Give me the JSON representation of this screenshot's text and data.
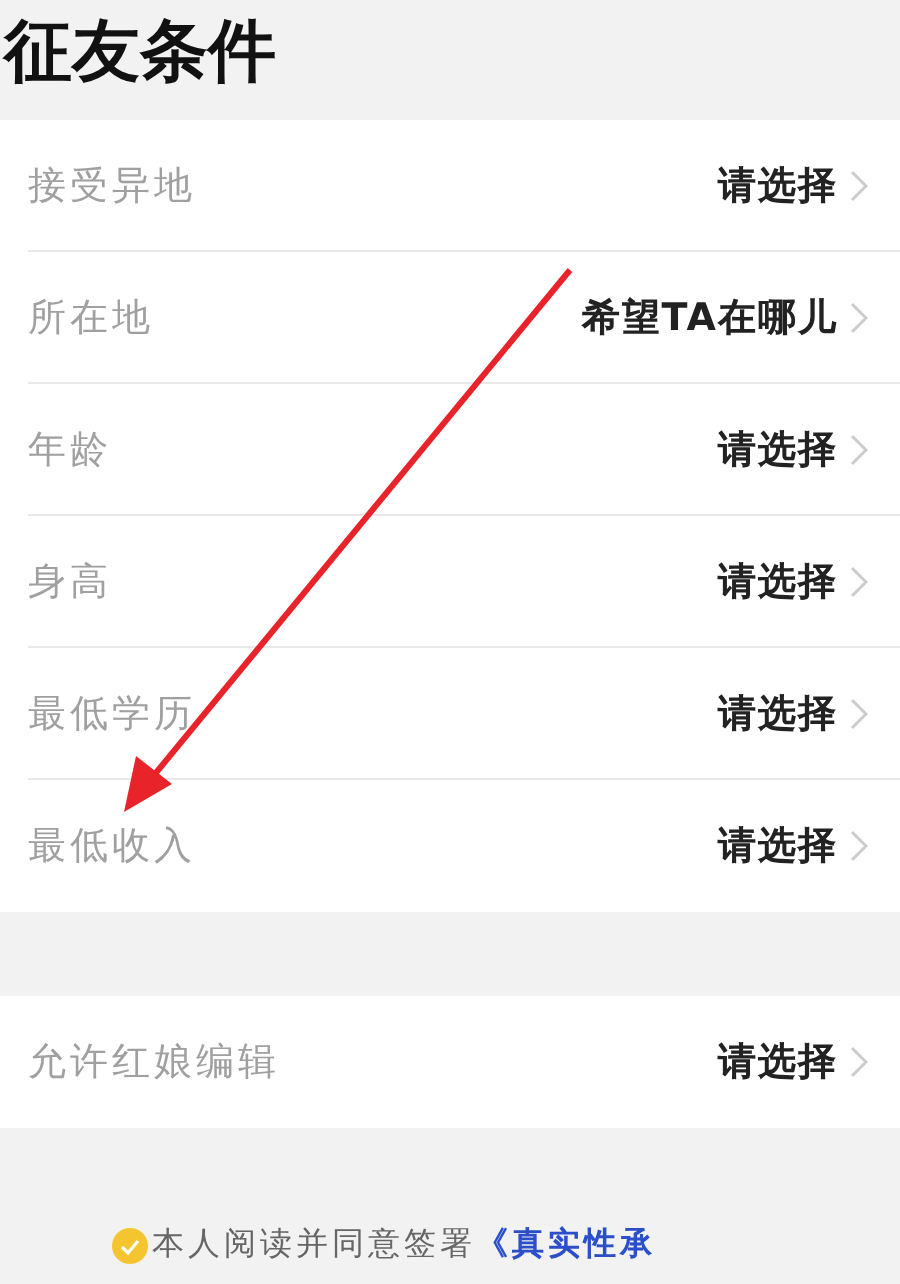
{
  "title": "征友条件",
  "groups": [
    {
      "rows": [
        {
          "label": "接受异地",
          "value": "请选择"
        },
        {
          "label": "所在地",
          "value": "希望TA在哪儿"
        },
        {
          "label": "年龄",
          "value": "请选择"
        },
        {
          "label": "身高",
          "value": "请选择"
        },
        {
          "label": "最低学历",
          "value": "请选择"
        },
        {
          "label": "最低收入",
          "value": "请选择"
        }
      ]
    },
    {
      "rows": [
        {
          "label": "允许红娘编辑",
          "value": "请选择"
        }
      ]
    }
  ],
  "agreement": {
    "checked": true,
    "text": "本人阅读并同意签署",
    "link": "《真实性承"
  },
  "annotation": {
    "kind": "arrow"
  }
}
